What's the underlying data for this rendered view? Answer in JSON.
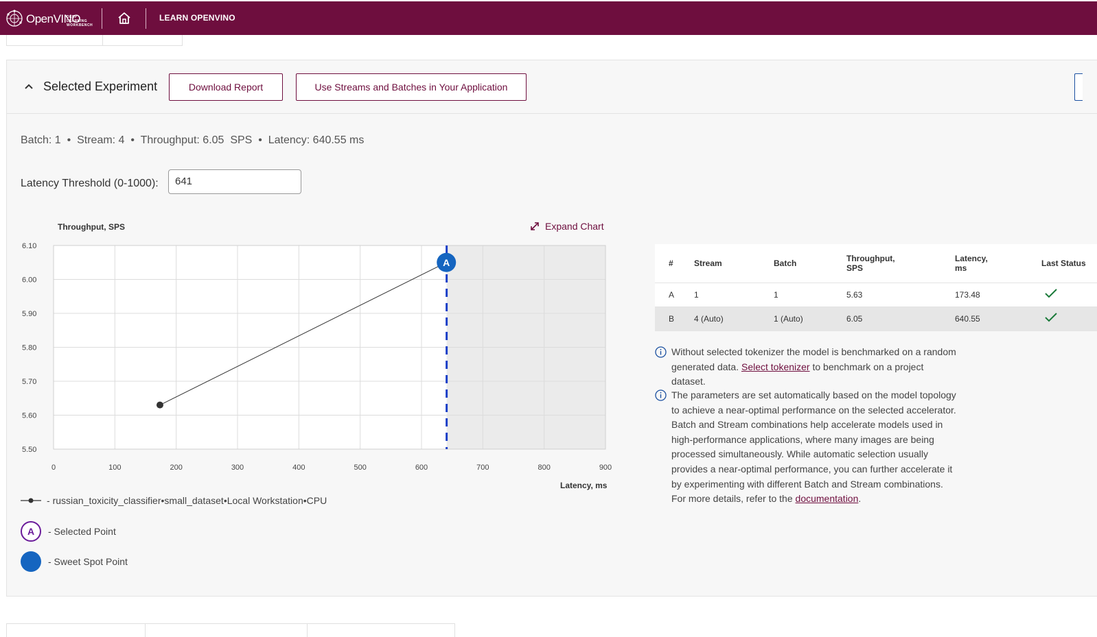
{
  "header": {
    "logo_text": "OpenVINO",
    "logo_subtext": "DEEP LEARNING WORKBENCH",
    "home_icon": "home-icon",
    "learn_link": "LEARN OPENVINO",
    "brand_color": "#6e0e3e"
  },
  "panel": {
    "title": "Selected Experiment",
    "download_button": "Download Report",
    "streams_button": "Use Streams and Batches in Your Application",
    "summary": {
      "batch": "Batch: 1",
      "stream": "Stream: 4",
      "throughput": "Throughput: 6.05  SPS",
      "latency": "Latency: 640.55 ms",
      "sep": "•"
    },
    "threshold_label": "Latency Threshold (0-1000):",
    "threshold_value": "641",
    "expand_chart": "Expand Chart"
  },
  "chart_data": {
    "type": "line",
    "ylabel": "Throughput, SPS",
    "xlabel": "Latency, ms",
    "xlim": [
      0,
      900
    ],
    "ylim": [
      5.5,
      6.1
    ],
    "x_ticks": [
      "0",
      "100",
      "200",
      "300",
      "400",
      "500",
      "600",
      "700",
      "800",
      "900"
    ],
    "y_ticks": [
      "6.10",
      "6.00",
      "5.90",
      "5.80",
      "5.70",
      "5.60",
      "5.50"
    ],
    "grid": true,
    "threshold": 641,
    "series": [
      {
        "name": "russian_toxicity_classifier",
        "x": [
          173.48,
          640.55
        ],
        "y": [
          5.63,
          6.05
        ]
      }
    ],
    "selected_point": {
      "label": "A",
      "x": 640.55,
      "y": 6.05
    },
    "colors": {
      "line": "#333333",
      "threshold": "#1a3fc8",
      "sweet_spot": "#1565c0",
      "shade": "#ebebeb"
    }
  },
  "legend": {
    "model": "russian_toxicity_classifier",
    "dataset": "small_dataset",
    "target": "Local Workstation",
    "device": "CPU",
    "sep": "•",
    "prefix": "- ",
    "selected_badge": "A",
    "selected_label": "- Selected Point",
    "sweet_label": "- Sweet Spot Point"
  },
  "table": {
    "headers": [
      "#",
      "Stream",
      "Batch",
      "Throughput,\nSPS",
      "Latency,\nms",
      "Last Status"
    ],
    "rows": [
      {
        "id": "A",
        "stream": "1",
        "batch": "1",
        "throughput": "5.63",
        "latency": "173.48",
        "status": "check-icon",
        "selected": false
      },
      {
        "id": "B",
        "stream": "4 (Auto)",
        "batch": "1 (Auto)",
        "throughput": "6.05",
        "latency": "640.55",
        "status": "check-icon",
        "selected": true
      }
    ]
  },
  "info1": {
    "before": "Without selected tokenizer the model is benchmarked on a random generated data. ",
    "link": "Select tokenizer",
    "after": " to benchmark on a project dataset."
  },
  "info2": {
    "text": "The parameters are set automatically based on the model topology to achieve a near-optimal performance on the selected accelerator. Batch and Stream combinations help accelerate models used in high-performance applications, where many images are being processed simultaneously. While automatic selection usually provides a near-optimal performance, you can further accelerate it by experimenting with different Batch and Stream combinations. For more details, refer to the ",
    "link": "documentation",
    "after": "."
  }
}
